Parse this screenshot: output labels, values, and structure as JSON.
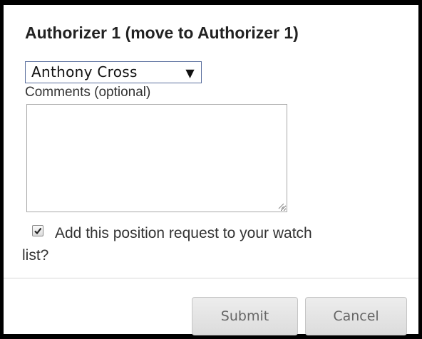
{
  "dialog": {
    "title": "Authorizer 1 (move to Authorizer 1)",
    "authorizer_select": {
      "selected": "Anthony Cross"
    },
    "comments": {
      "label": "Comments (optional)",
      "value": ""
    },
    "watch_list": {
      "checked": true,
      "label_line1": "Add this position request to your watch",
      "label_line2": "list?"
    },
    "buttons": {
      "submit": "Submit",
      "cancel": "Cancel"
    }
  },
  "icons": {
    "select_arrow": "dropdown-arrow-icon",
    "checkbox_check": "checkmark-icon",
    "resize": "resize-grip-icon"
  }
}
